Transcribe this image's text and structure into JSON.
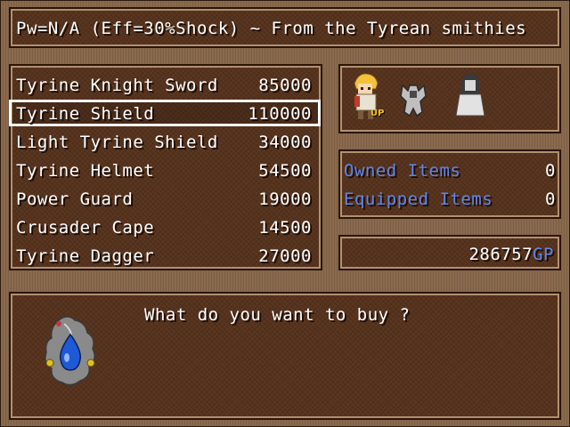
{
  "help": {
    "text": "Pw=N/A (Eff=30%Shock) ~ From the Tyrean smithies"
  },
  "shop_items": [
    {
      "name": "Tyrine Knight Sword",
      "price": "85000"
    },
    {
      "name": "Tyrine Shield",
      "price": "110000"
    },
    {
      "name": "Light Tyrine Shield",
      "price": "34000"
    },
    {
      "name": "Tyrine Helmet",
      "price": "54500"
    },
    {
      "name": "Power Guard",
      "price": "19000"
    },
    {
      "name": "Crusader Cape",
      "price": "14500"
    },
    {
      "name": "Tyrine Dagger",
      "price": "27000"
    }
  ],
  "selected_index": 1,
  "party": {
    "up_badge": "UP"
  },
  "stats": {
    "owned_label": "Owned Items",
    "owned_value": "0",
    "equipped_label": "Equipped Items",
    "equipped_value": "0"
  },
  "gold": {
    "amount": "286757",
    "unit": "GP"
  },
  "message": {
    "text": "What do you want to buy ?"
  },
  "colors": {
    "label_blue": "#5f86ea",
    "panel": "#5a3620",
    "frame": "#8a6a4e"
  }
}
